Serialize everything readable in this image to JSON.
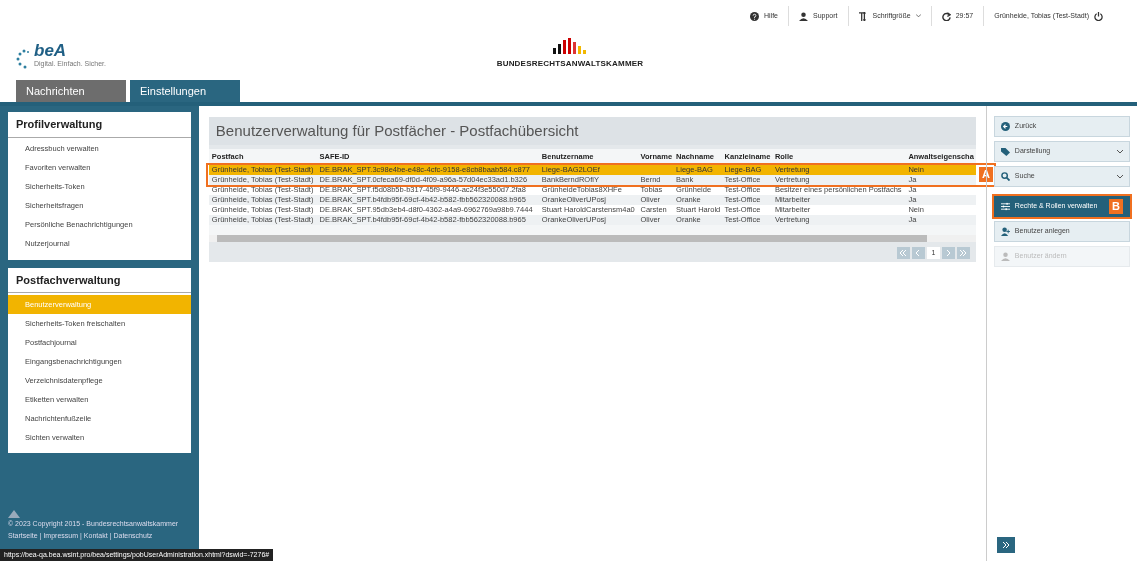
{
  "top_bar": [
    {
      "kind": "help",
      "label": "Hilfe"
    },
    {
      "kind": "user",
      "label": "Support"
    },
    {
      "kind": "font",
      "label": "Schriftgröße"
    },
    {
      "kind": "timer",
      "label": "29:57"
    },
    {
      "kind": "logout",
      "label": "Grünheide, Tobias (Test-Stadt)"
    }
  ],
  "header": {
    "logo_text": "beA",
    "logo_tagline": "Digital. Einfach. Sicher.",
    "brand": "BUNDESRECHTSANWALTSKAMMER"
  },
  "tabs": [
    {
      "label": "Nachrichten",
      "selected": false
    },
    {
      "label": "Einstellungen",
      "selected": true
    }
  ],
  "sidebar": [
    {
      "title": "Profilverwaltung",
      "items": [
        {
          "label": "Adressbuch verwalten",
          "selected": false
        },
        {
          "label": "Favoriten verwalten",
          "selected": false
        },
        {
          "label": "Sicherheits-Token",
          "selected": false
        },
        {
          "label": "Sicherheitsfragen",
          "selected": false
        },
        {
          "label": "Persönliche Benachrichtigungen",
          "selected": false
        },
        {
          "label": "Nutzerjournal",
          "selected": false
        }
      ]
    },
    {
      "title": "Postfachverwaltung",
      "items": [
        {
          "label": "Benutzerverwaltung",
          "selected": true
        },
        {
          "label": "Sicherheits-Token freischalten",
          "selected": false
        },
        {
          "label": "Postfachjournal",
          "selected": false
        },
        {
          "label": "Eingangsbenachrichtigungen",
          "selected": false
        },
        {
          "label": "Verzeichnisdatenpflege",
          "selected": false
        },
        {
          "label": "Etiketten verwalten",
          "selected": false
        },
        {
          "label": "Nachrichtenfußzeile",
          "selected": false
        },
        {
          "label": "Sichten verwalten",
          "selected": false
        }
      ]
    }
  ],
  "footer": {
    "copyright": "© 2023 Copyright 2015 - Bundesrechtsanwaltskammer",
    "links": [
      "Startseite",
      "Impressum",
      "Kontakt",
      "Datenschutz"
    ],
    "separator": "|"
  },
  "main": {
    "title": "Benutzerverwaltung für Postfächer - Postfachübersicht",
    "table": {
      "columns": [
        "Postfach",
        "SAFE-ID",
        "Benutzername",
        "Vorname",
        "Nachname",
        "Kanzleiname",
        "Rolle",
        "Anwaltseigenscha"
      ],
      "rows": [
        {
          "selected": true,
          "cells": [
            "Grünheide, Tobias (Test-Stadt)",
            "DE.BRAK_SPT.3c98e4be-e48c-4cfc-9158-e8cb8baab584.c877",
            "Liege-BAG2LOEf",
            "",
            "Liege-BAG",
            "Liege-BAG",
            "Vertretung",
            "Nein"
          ]
        },
        {
          "selected": false,
          "cells": [
            "Grünheide, Tobias (Test-Stadt)",
            "DE.BRAK_SPT.0cfeca69-df0d-4f09-a96a-57d04ec33ad1.b326",
            "BankBerndROfiY",
            "Bernd",
            "Bank",
            "Test-Office",
            "Vertretung",
            "Ja"
          ]
        },
        {
          "selected": false,
          "cells": [
            "Grünheide, Tobias (Test-Stadt)",
            "DE.BRAK_SPT.f5d08b5b-b317-45f9-9446-ac24f3e550d7.2fa8",
            "GrünheideTobias8XHFe",
            "Tobias",
            "Grünheide",
            "Test-Office",
            "Besitzer eines persönlichen Postfachs",
            "Ja"
          ]
        },
        {
          "selected": false,
          "cells": [
            "Grünheide, Tobias (Test-Stadt)",
            "DE.BRAK_SPT.b4fdb95f-69cf-4b42-b582-fbb562320088.b965",
            "OrankeOliverUPosj",
            "Oliver",
            "Oranke",
            "Test-Office",
            "Mitarbeiter",
            "Ja"
          ]
        },
        {
          "selected": false,
          "cells": [
            "Grünheide, Tobias (Test-Stadt)",
            "DE.BRAK_SPT.95db3eb4-d8f0-4362-a4a9-6962769a98b9.7444",
            "Stuart HaroldCarstensm4a0",
            "Carsten",
            "Stuart Harold",
            "Test-Office",
            "Mitarbeiter",
            "Nein"
          ]
        },
        {
          "selected": false,
          "cells": [
            "Grünheide, Tobias (Test-Stadt)",
            "DE.BRAK_SPT.b4fdb95f-69cf-4b42-b582-fbb562320088.b965",
            "OrankeOliverUPosj",
            "Oliver",
            "Oranke",
            "Test-Office",
            "Vertretung",
            "Ja"
          ]
        }
      ]
    },
    "pager": {
      "current": "1"
    }
  },
  "actions": [
    {
      "kind": "back",
      "label": "Zurück",
      "dropdown": false,
      "highlighted": false,
      "disabled": false
    },
    {
      "kind": "tags",
      "label": "Darstellung",
      "dropdown": true,
      "highlighted": false,
      "disabled": false
    },
    {
      "kind": "search",
      "label": "Suche",
      "dropdown": true,
      "highlighted": false,
      "disabled": false
    },
    {
      "kind": "sliders",
      "label": "Rechte & Rollen verwalten",
      "dropdown": false,
      "highlighted": true,
      "disabled": false
    },
    {
      "kind": "adduser",
      "label": "Benutzer anlegen",
      "dropdown": false,
      "highlighted": false,
      "disabled": false
    },
    {
      "kind": "user",
      "label": "Benutzer ändern",
      "dropdown": false,
      "highlighted": false,
      "disabled": true
    }
  ],
  "annotations": [
    {
      "label": "A"
    },
    {
      "label": "B"
    }
  ],
  "status_url": "https://bea-qa.bea.wsint.pro/bea/settings/pobUserAdministration.xhtml?dswid=-7276#"
}
